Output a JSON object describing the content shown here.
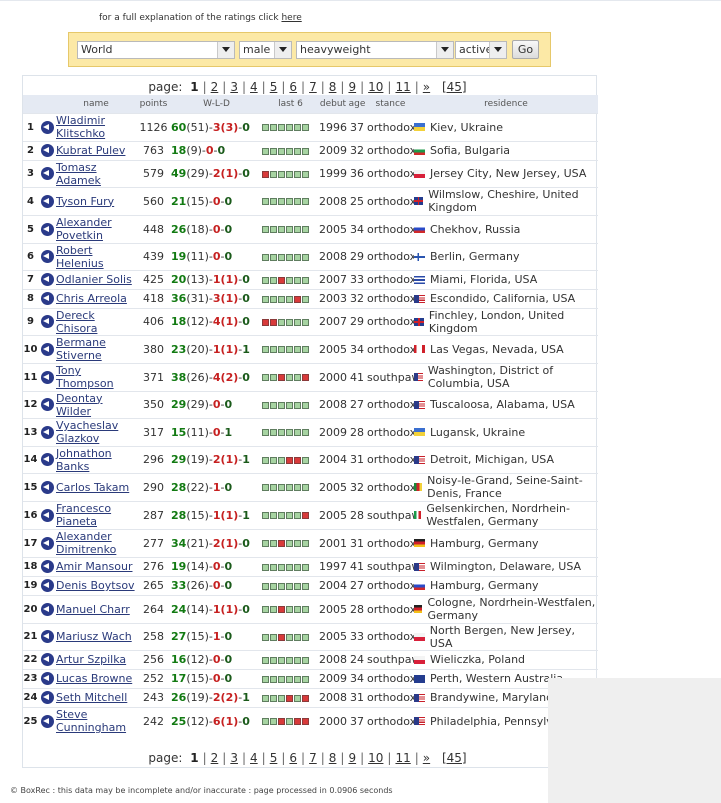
{
  "header": {
    "note_text": "for a full explanation of the ratings click",
    "note_link": "here"
  },
  "filters": {
    "region": "World",
    "sex": "male",
    "division": "heavyweight",
    "status": "active",
    "go_label": "Go"
  },
  "pager": {
    "label": "page:",
    "pages": [
      "1",
      "2",
      "3",
      "4",
      "5",
      "6",
      "7",
      "8",
      "9",
      "10",
      "11"
    ],
    "current": "1",
    "next": "»",
    "last": "[45]"
  },
  "columns": {
    "name": "name",
    "points": "points",
    "wld": "W-L-D",
    "last6": "last 6",
    "debut": "debut",
    "age": "age",
    "stance": "stance",
    "residence": "residence"
  },
  "colors": {
    "win": "#127a12",
    "loss": "#c62020",
    "good_bar": "#a7d4a2",
    "bad_bar": "#d83a3a"
  },
  "rows": [
    {
      "rank": "1",
      "name": "Wladimir Klitschko",
      "points": "1126",
      "w": "60",
      "ko": "(51)",
      "l": "3",
      "lko": "(3)",
      "d": "0",
      "last6": "gggggg",
      "debut": "1996",
      "age": "37",
      "stance": "orthodox",
      "flag": "ua",
      "residence": "Kiev, Ukraine"
    },
    {
      "rank": "2",
      "name": "Kubrat Pulev",
      "points": "763",
      "w": "18",
      "ko": "(9)",
      "l": "0",
      "lko": "",
      "d": "0",
      "last6": "gggggg",
      "debut": "2009",
      "age": "32",
      "stance": "orthodox",
      "flag": "bg",
      "residence": "Sofia, Bulgaria"
    },
    {
      "rank": "3",
      "name": "Tomasz Adamek",
      "points": "579",
      "w": "49",
      "ko": "(29)",
      "l": "2",
      "lko": "(1)",
      "d": "0",
      "last6": "rggggg",
      "debut": "1999",
      "age": "36",
      "stance": "orthodox",
      "flag": "pl",
      "residence": "Jersey City, New Jersey, USA"
    },
    {
      "rank": "4",
      "name": "Tyson Fury",
      "points": "560",
      "w": "21",
      "ko": "(15)",
      "l": "0",
      "lko": "",
      "d": "0",
      "last6": "gggggg",
      "debut": "2008",
      "age": "25",
      "stance": "orthodox",
      "flag": "gb",
      "residence": "Wilmslow, Cheshire, United Kingdom"
    },
    {
      "rank": "5",
      "name": "Alexander Povetkin",
      "points": "448",
      "w": "26",
      "ko": "(18)",
      "l": "0",
      "lko": "",
      "d": "0",
      "last6": "gggggg",
      "debut": "2005",
      "age": "34",
      "stance": "orthodox",
      "flag": "ru",
      "residence": "Chekhov, Russia"
    },
    {
      "rank": "6",
      "name": "Robert Helenius",
      "points": "439",
      "w": "19",
      "ko": "(11)",
      "l": "0",
      "lko": "",
      "d": "0",
      "last6": "gggggg",
      "debut": "2008",
      "age": "29",
      "stance": "orthodox",
      "flag": "fi",
      "residence": "Berlin, Germany"
    },
    {
      "rank": "7",
      "name": "Odlanier Solis",
      "points": "425",
      "w": "20",
      "ko": "(13)",
      "l": "1",
      "lko": "(1)",
      "d": "0",
      "last6": "ggrggg",
      "debut": "2007",
      "age": "33",
      "stance": "orthodox",
      "flag": "cu",
      "residence": "Miami, Florida, USA"
    },
    {
      "rank": "8",
      "name": "Chris Arreola",
      "points": "418",
      "w": "36",
      "ko": "(31)",
      "l": "3",
      "lko": "(1)",
      "d": "0",
      "last6": "ggggrg",
      "debut": "2003",
      "age": "32",
      "stance": "orthodox",
      "flag": "us",
      "residence": "Escondido, California, USA"
    },
    {
      "rank": "9",
      "name": "Dereck Chisora",
      "points": "406",
      "w": "18",
      "ko": "(12)",
      "l": "4",
      "lko": "(1)",
      "d": "0",
      "last6": "rrgggg",
      "debut": "2007",
      "age": "29",
      "stance": "orthodox",
      "flag": "gb",
      "residence": "Finchley, London, United Kingdom"
    },
    {
      "rank": "10",
      "name": "Bermane Stiverne",
      "points": "380",
      "w": "23",
      "ko": "(20)",
      "l": "1",
      "lko": "(1)",
      "d": "1",
      "last6": "gggggg",
      "debut": "2005",
      "age": "34",
      "stance": "orthodox",
      "flag": "ca",
      "residence": "Las Vegas, Nevada, USA"
    },
    {
      "rank": "11",
      "name": "Tony Thompson",
      "points": "371",
      "w": "38",
      "ko": "(26)",
      "l": "4",
      "lko": "(2)",
      "d": "0",
      "last6": "ggrggr",
      "debut": "2000",
      "age": "41",
      "stance": "southpaw",
      "flag": "us",
      "residence": "Washington, District of Columbia, USA"
    },
    {
      "rank": "12",
      "name": "Deontay Wilder",
      "points": "350",
      "w": "29",
      "ko": "(29)",
      "l": "0",
      "lko": "",
      "d": "0",
      "last6": "gggggg",
      "debut": "2008",
      "age": "27",
      "stance": "orthodox",
      "flag": "us",
      "residence": "Tuscaloosa, Alabama, USA"
    },
    {
      "rank": "13",
      "name": "Vyacheslav Glazkov",
      "points": "317",
      "w": "15",
      "ko": "(11)",
      "l": "0",
      "lko": "",
      "d": "1",
      "last6": "gggggg",
      "debut": "2009",
      "age": "28",
      "stance": "orthodox",
      "flag": "ua",
      "residence": "Lugansk, Ukraine"
    },
    {
      "rank": "14",
      "name": "Johnathon Banks",
      "points": "296",
      "w": "29",
      "ko": "(19)",
      "l": "2",
      "lko": "(1)",
      "d": "1",
      "last6": "gggrrg",
      "debut": "2004",
      "age": "31",
      "stance": "orthodox",
      "flag": "us",
      "residence": "Detroit, Michigan, USA"
    },
    {
      "rank": "15",
      "name": "Carlos Takam",
      "points": "290",
      "w": "28",
      "ko": "(22)",
      "l": "1",
      "lko": "",
      "d": "0",
      "last6": "gggggg",
      "debut": "2005",
      "age": "32",
      "stance": "orthodox",
      "flag": "cm",
      "residence": "Noisy-le-Grand, Seine-Saint-Denis, France"
    },
    {
      "rank": "16",
      "name": "Francesco Pianeta",
      "points": "287",
      "w": "28",
      "ko": "(15)",
      "l": "1",
      "lko": "(1)",
      "d": "1",
      "last6": "gggggr",
      "debut": "2005",
      "age": "28",
      "stance": "southpaw",
      "flag": "it",
      "residence": "Gelsenkirchen, Nordrhein-Westfalen, Germany"
    },
    {
      "rank": "17",
      "name": "Alexander Dimitrenko",
      "points": "277",
      "w": "34",
      "ko": "(21)",
      "l": "2",
      "lko": "(1)",
      "d": "0",
      "last6": "ggrggg",
      "debut": "2001",
      "age": "31",
      "stance": "orthodox",
      "flag": "de",
      "residence": "Hamburg, Germany"
    },
    {
      "rank": "18",
      "name": "Amir Mansour",
      "points": "276",
      "w": "19",
      "ko": "(14)",
      "l": "0",
      "lko": "",
      "d": "0",
      "last6": "gggggg",
      "debut": "1997",
      "age": "41",
      "stance": "southpaw",
      "flag": "us",
      "residence": "Wilmington, Delaware, USA"
    },
    {
      "rank": "19",
      "name": "Denis Boytsov",
      "points": "265",
      "w": "33",
      "ko": "(26)",
      "l": "0",
      "lko": "",
      "d": "0",
      "last6": "gggggg",
      "debut": "2004",
      "age": "27",
      "stance": "orthodox",
      "flag": "ru",
      "residence": "Hamburg, Germany"
    },
    {
      "rank": "20",
      "name": "Manuel Charr",
      "points": "264",
      "w": "24",
      "ko": "(14)",
      "l": "1",
      "lko": "(1)",
      "d": "0",
      "last6": "ggrggg",
      "debut": "2005",
      "age": "28",
      "stance": "orthodox",
      "flag": "de",
      "residence": "Cologne, Nordrhein-Westfalen, Germany"
    },
    {
      "rank": "21",
      "name": "Mariusz Wach",
      "points": "258",
      "w": "27",
      "ko": "(15)",
      "l": "1",
      "lko": "",
      "d": "0",
      "last6": "ggrggg",
      "debut": "2005",
      "age": "33",
      "stance": "orthodox",
      "flag": "pl",
      "residence": "North Bergen, New Jersey, USA"
    },
    {
      "rank": "22",
      "name": "Artur Szpilka",
      "points": "256",
      "w": "16",
      "ko": "(12)",
      "l": "0",
      "lko": "",
      "d": "0",
      "last6": "gggggg",
      "debut": "2008",
      "age": "24",
      "stance": "southpaw",
      "flag": "pl",
      "residence": "Wieliczka, Poland"
    },
    {
      "rank": "23",
      "name": "Lucas Browne",
      "points": "252",
      "w": "17",
      "ko": "(15)",
      "l": "0",
      "lko": "",
      "d": "0",
      "last6": "gggggg",
      "debut": "2009",
      "age": "34",
      "stance": "orthodox",
      "flag": "au",
      "residence": "Perth, Western Australia"
    },
    {
      "rank": "24",
      "name": "Seth Mitchell",
      "points": "243",
      "w": "26",
      "ko": "(19)",
      "l": "2",
      "lko": "(2)",
      "d": "1",
      "last6": "gggrgr",
      "debut": "2008",
      "age": "31",
      "stance": "orthodox",
      "flag": "us",
      "residence": "Brandywine, Maryland, U"
    },
    {
      "rank": "25",
      "name": "Steve Cunningham",
      "points": "242",
      "w": "25",
      "ko": "(12)",
      "l": "6",
      "lko": "(1)",
      "d": "0",
      "last6": "ggrgrr",
      "debut": "2000",
      "age": "37",
      "stance": "orthodox",
      "flag": "us",
      "residence": "Philadelphia, Pennsylvan"
    }
  ],
  "footer": {
    "text": "© BoxRec : this data may be incomplete and/or inaccurate : page processed in 0.0906 seconds"
  }
}
